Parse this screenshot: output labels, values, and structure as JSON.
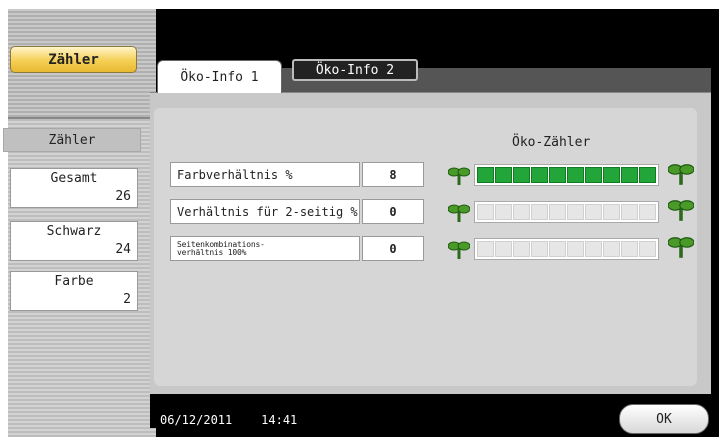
{
  "sidebar": {
    "main_button": "Zähler",
    "section_title": "Zähler",
    "counters": [
      {
        "label": "Gesamt",
        "value": "26"
      },
      {
        "label": "Schwarz",
        "value": "24"
      },
      {
        "label": "Farbe",
        "value": "2"
      }
    ]
  },
  "tabs": [
    {
      "label": "Öko-Info 1",
      "active": true
    },
    {
      "label": "Öko-Info 2",
      "active": false
    }
  ],
  "eco": {
    "title": "Öko-Zähler",
    "rows": [
      {
        "label": "Farbverhältnis %",
        "value": "8",
        "bar_fraction": 1.0
      },
      {
        "label": "Verhältnis für 2-seitig %",
        "value": "0",
        "bar_fraction": 0.0
      },
      {
        "label": "Seitenkombinations-\nverhältnis 100%",
        "value": "0",
        "bar_fraction": 0.0
      }
    ],
    "bar_segments": 10,
    "icon": "sprout-icon",
    "fill_color": "#22a63a"
  },
  "footer": {
    "date": "06/12/2011",
    "time": "14:41",
    "ok_label": "OK"
  }
}
